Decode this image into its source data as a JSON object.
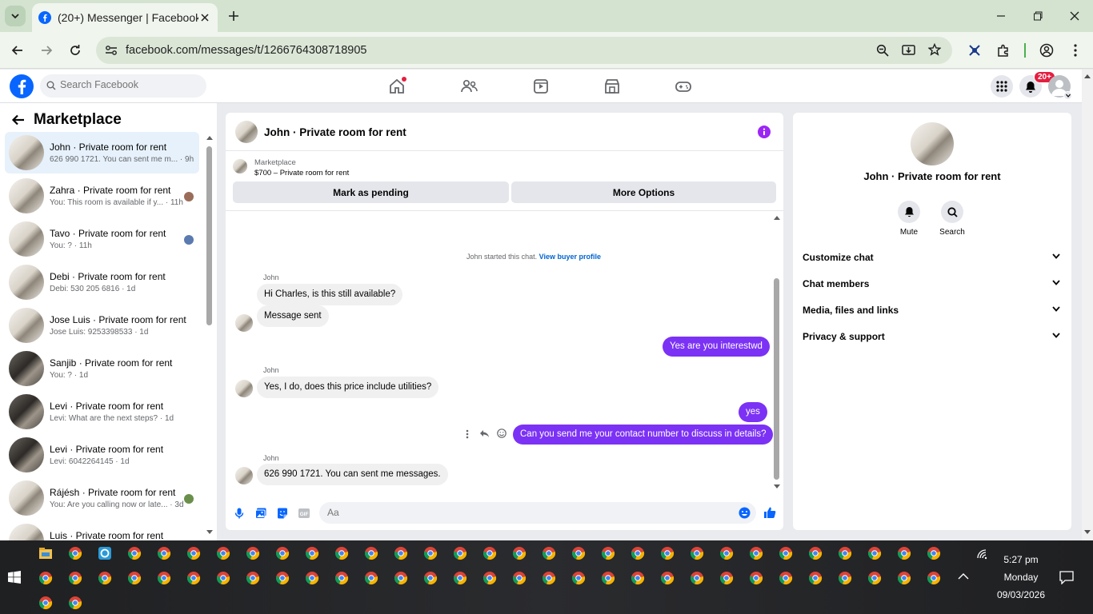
{
  "browser": {
    "tab_title": "(20+) Messenger | Facebook",
    "url": "facebook.com/messages/t/1266764308718905"
  },
  "fb": {
    "search_placeholder": "Search Facebook",
    "notif_badge": "20+"
  },
  "left": {
    "title": "Marketplace",
    "conversations": [
      {
        "name": "John · Private room for rent",
        "preview": "626 990 1721. You can sent me m... · 9h",
        "active": true
      },
      {
        "name": "Zahra · Private room for rent",
        "preview": "You: This room is available if y... · 11h"
      },
      {
        "name": "Tavo · Private room for rent",
        "preview": "You: ? · 11h"
      },
      {
        "name": "Debi · Private room for rent",
        "preview": "Debi: 530 205 6816 · 1d"
      },
      {
        "name": "Jose Luis · Private room for rent",
        "preview": "Jose Luis: 9253398533 · 1d"
      },
      {
        "name": "Sanjib · Private room for rent",
        "preview": "You: ? · 1d"
      },
      {
        "name": "Levi · Private room for rent",
        "preview": "Levi: What are the next steps? · 1d"
      },
      {
        "name": "Levi · Private room for rent",
        "preview": "Levi: 6042264145 · 1d"
      },
      {
        "name": "Rájésh · Private room for rent",
        "preview": "You: Are you calling now or late... · 3d"
      },
      {
        "name": "Luis · Private room for rent",
        "preview": ""
      }
    ]
  },
  "chat": {
    "header_name": "John · Private room for rent",
    "marketplace_label": "Marketplace",
    "listing": "$700 – Private room for rent",
    "mark_pending": "Mark as pending",
    "more_options": "More Options",
    "started_text": "John started this chat.",
    "view_profile": "View buyer profile",
    "messages": [
      {
        "sender": "John",
        "text": "Hi Charles, is this still available?"
      },
      {
        "text": "Message sent"
      },
      {
        "out": true,
        "text": "Yes are you interestwd"
      },
      {
        "sender": "John",
        "text": "Yes, I do, does this price include utilities?"
      },
      {
        "out": true,
        "text": "yes"
      },
      {
        "out": true,
        "text": "Can you send me your contact number to discuss in details?"
      },
      {
        "sender": "John",
        "text": "626 990 1721.  You can sent me messages."
      }
    ],
    "composer_placeholder": "Aa"
  },
  "right": {
    "name": "John · Private room for rent",
    "mute": "Mute",
    "search": "Search",
    "rows": [
      "Customize chat",
      "Chat members",
      "Media, files and links",
      "Privacy & support"
    ]
  },
  "taskbar": {
    "time": "5:27 pm",
    "day": "Monday",
    "date": "09/03/2026"
  },
  "colors": {
    "messenger_purple": "#7b32f5",
    "fb_blue": "#0866ff",
    "badge_red": "#e41e3f"
  }
}
